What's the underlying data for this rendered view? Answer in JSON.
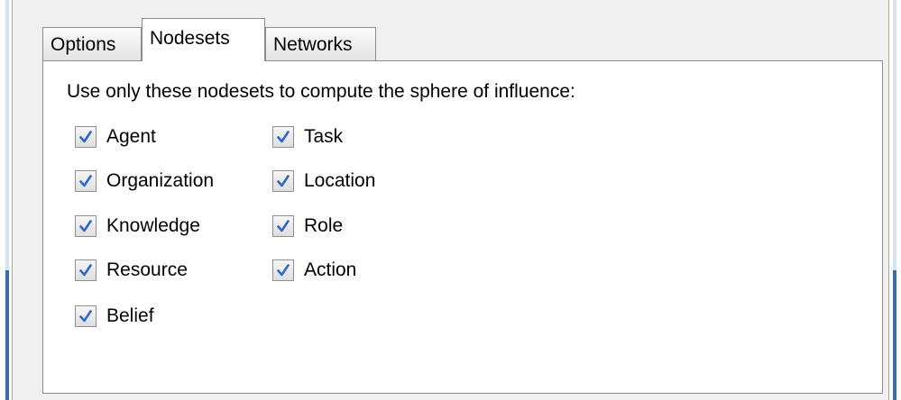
{
  "tabs": [
    {
      "label": "Options",
      "active": false
    },
    {
      "label": "Nodesets",
      "active": true
    },
    {
      "label": "Networks",
      "active": false
    }
  ],
  "nodesets_panel": {
    "instructions": "Use only these nodesets to compute the sphere of influence:",
    "checkboxes": [
      {
        "label": "Agent",
        "checked": true
      },
      {
        "label": "Organization",
        "checked": true
      },
      {
        "label": "Knowledge",
        "checked": true
      },
      {
        "label": "Resource",
        "checked": true
      },
      {
        "label": "Belief",
        "checked": true
      },
      {
        "label": "Task",
        "checked": true
      },
      {
        "label": "Location",
        "checked": true
      },
      {
        "label": "Role",
        "checked": true
      },
      {
        "label": "Action",
        "checked": true
      }
    ]
  },
  "colors": {
    "checkmark": "#3366cc",
    "window_border": "#3a6ea5",
    "dialog_background": "#f0f0f0"
  },
  "icons": {
    "checkbox_mark": "check-icon"
  }
}
